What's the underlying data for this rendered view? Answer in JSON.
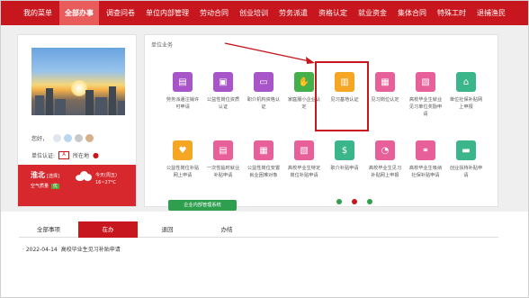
{
  "nav": {
    "items": [
      {
        "label": "我的菜单",
        "active": false
      },
      {
        "label": "全部办事",
        "active": true
      },
      {
        "label": "调查问卷",
        "active": false
      },
      {
        "label": "单位内部管理",
        "active": false
      },
      {
        "label": "劳动合同",
        "active": false
      },
      {
        "label": "创业培训",
        "active": false
      },
      {
        "label": "劳务派遣",
        "active": false
      },
      {
        "label": "资格认定",
        "active": false
      },
      {
        "label": "就业资金",
        "active": false
      },
      {
        "label": "集体合同",
        "active": false
      },
      {
        "label": "特殊工时",
        "active": false
      },
      {
        "label": "退捕渔民",
        "active": false
      }
    ]
  },
  "profile": {
    "name_label": "您好，",
    "cert_label": "单位认证:",
    "cert_icon_text": "A",
    "location_label": "所在地",
    "weather": {
      "city": "淮北",
      "district": "[选择]",
      "air_quality_label": "空气质量",
      "air_quality_value": "优",
      "day": "今天(周五)",
      "temp": "16~27°C"
    }
  },
  "services": {
    "title": "单位业务",
    "items": [
      {
        "label": "劳务派遣注销许可申请",
        "color": "#a855c9",
        "icon": "document-icon",
        "glyph": "▤"
      },
      {
        "label": "公益性岗位资质认证",
        "color": "#a855c9",
        "icon": "badge-icon",
        "glyph": "▣"
      },
      {
        "label": "职介机构资格认证",
        "color": "#a855c9",
        "icon": "monitor-icon",
        "glyph": "▭"
      },
      {
        "label": "家庭服小企业认定",
        "color": "#43b04a",
        "icon": "hand-icon",
        "glyph": "✋"
      },
      {
        "label": "见习基地认证",
        "color": "#f5a623",
        "icon": "certificate-icon",
        "glyph": "▥"
      },
      {
        "label": "见习岗位认定",
        "color": "#e8609a",
        "icon": "post-icon",
        "glyph": "▦"
      },
      {
        "label": "高校毕业生就业见习单位奖励申请",
        "color": "#e8609a",
        "icon": "award-icon",
        "glyph": "▧"
      },
      {
        "label": "单位社保补贴网上申报",
        "color": "#3bb58a",
        "icon": "bank-icon",
        "glyph": "⌂"
      },
      {
        "label": "公益性岗位补贴网上申请",
        "color": "#f5a623",
        "icon": "heart-icon",
        "glyph": "♥"
      },
      {
        "label": "一次性临时就业补贴申请",
        "color": "#e8609a",
        "icon": "form-icon",
        "glyph": "▤"
      },
      {
        "label": "公益性岗位安置就业困难对象",
        "color": "#e8609a",
        "icon": "people-icon",
        "glyph": "▦"
      },
      {
        "label": "高校毕业生特定岗位补贴申请",
        "color": "#e8609a",
        "icon": "graduate-icon",
        "glyph": "▧"
      },
      {
        "label": "职介补贴申请",
        "color": "#3bb58a",
        "icon": "money-bag-icon",
        "glyph": "$"
      },
      {
        "label": "高校毕业生见习补贴网上申报",
        "color": "#e8609a",
        "icon": "chart-icon",
        "glyph": "◔"
      },
      {
        "label": "高校毕业生吸纳社保补贴申请",
        "color": "#e8609a",
        "icon": "handshake-icon",
        "glyph": "⚭"
      },
      {
        "label": "创业扶持补贴申请",
        "color": "#3bb58a",
        "icon": "briefcase-icon",
        "glyph": "▬"
      }
    ],
    "button_label": "企业内部管理系统"
  },
  "tabs": {
    "items": [
      {
        "label": "全部事项",
        "active": false
      },
      {
        "label": "在办",
        "active": true
      },
      {
        "label": "退回",
        "active": false
      },
      {
        "label": "办结",
        "active": false
      }
    ]
  },
  "list": {
    "items": [
      {
        "date": "2022-04-14",
        "title": "高校毕业生见习补贴申请"
      }
    ]
  }
}
